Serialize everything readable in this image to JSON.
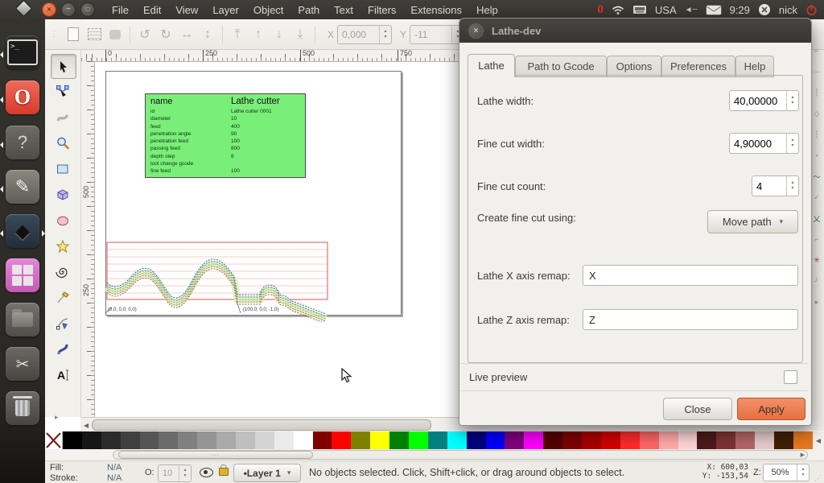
{
  "colors": {
    "accent_orange": "#e8703f",
    "table_green": "#79ef79",
    "panel_bg": "#3a3834"
  },
  "icons": {
    "close_x": "×",
    "minimize": "−",
    "maximize": "□",
    "chevron_down": "▾",
    "spin_up": "▴",
    "spin_down": "▾",
    "arrow_left": "◀",
    "arrow_right": "▶",
    "expander_right": "▸",
    "overflow_down": "▾",
    "grip_dots": "⋯",
    "undo": "↺",
    "redo": "↻",
    "flip_h": "↔",
    "flip_v": "↕",
    "raise_top": "⤒",
    "raise": "↑",
    "lower": "↓",
    "lower_bottom": "⤓",
    "terminal_prompt": ">_",
    "opera_o": "O",
    "help_q": "?",
    "edit_pencil": "✎",
    "inkscape_diamond": "◆",
    "scissors": "✂",
    "speaker_muted": "◄┄",
    "power": "⏻"
  },
  "panel": {
    "menus": [
      "File",
      "Edit",
      "View",
      "Layer",
      "Object",
      "Path",
      "Text",
      "Filters",
      "Extensions",
      "Help"
    ],
    "keyboard_layout": "USA",
    "clock": "9:29",
    "username": "nick"
  },
  "toolbar": {
    "x_label": "X",
    "x_value": "0,000",
    "y_label": "Y",
    "y_value": "-11"
  },
  "rulers": {
    "h": [
      "0",
      "250",
      "500",
      "750"
    ],
    "v": [
      "500",
      "250"
    ]
  },
  "canvas": {
    "table": {
      "header": {
        "name": "name",
        "value": "Lathe cutter"
      },
      "rows": [
        {
          "name": "id",
          "value": "Lathe cutter 0001"
        },
        {
          "name": "diameter",
          "value": "10"
        },
        {
          "name": "feed",
          "value": "400"
        },
        {
          "name": "penetration angle",
          "value": "90"
        },
        {
          "name": "penetration feed",
          "value": "100"
        },
        {
          "name": "passing feed",
          "value": "800"
        },
        {
          "name": "depth step",
          "value": "8"
        },
        {
          "name": "tool change gcode",
          "value": ""
        },
        {
          "name": "fine feed",
          "value": "100"
        }
      ]
    },
    "labels": {
      "origin": "(0,0; 0,0; 0,0)",
      "end": "(100,0; 0,0; -1,0)"
    }
  },
  "dialog": {
    "title": "Lathe-dev",
    "tabs": [
      "Lathe",
      "Path to Gcode",
      "Options",
      "Preferences",
      "Help"
    ],
    "active_tab": "Lathe",
    "fields": {
      "lathe_width": {
        "label": "Lathe width:",
        "value": "40,00000"
      },
      "fine_cut_width": {
        "label": "Fine cut width:",
        "value": "4,90000"
      },
      "fine_cut_count": {
        "label": "Fine cut count:",
        "value": "4"
      },
      "create_fine_cut": {
        "label": "Create fine cut using:",
        "value": "Move path"
      },
      "x_remap": {
        "label": "Lathe X axis remap:",
        "value": "X"
      },
      "z_remap": {
        "label": "Lathe Z axis remap:",
        "value": "Z"
      }
    },
    "live_preview_label": "Live preview",
    "buttons": {
      "close": "Close",
      "apply": "Apply"
    }
  },
  "statusbar": {
    "fill_label": "Fill:",
    "fill_value": "N/A",
    "stroke_label": "Stroke:",
    "stroke_value": "N/A",
    "opacity_label": "O:",
    "opacity_value": "10",
    "layer_button": "•Layer 1",
    "message": "No objects selected. Click, Shift+click, or drag around objects to select.",
    "x_label": "X:",
    "x_value": "600,03",
    "y_label": "Y:",
    "y_value": "-153,54",
    "z_label": "Z:",
    "zoom_value": "50%"
  },
  "palette": {
    "colors": [
      "#000000",
      "#161616",
      "#2b2b2b",
      "#404040",
      "#555555",
      "#6b6b6b",
      "#808080",
      "#959595",
      "#aaaaaa",
      "#bfbfbf",
      "#d4d4d4",
      "#eaeaea",
      "#ffffff",
      "#800000",
      "#ff0000",
      "#808000",
      "#ffff00",
      "#008000",
      "#00ff00",
      "#008080",
      "#00ffff",
      "#000080",
      "#0000ff",
      "#800080",
      "#ff00ff",
      "#550000",
      "#7f0000",
      "#aa0000",
      "#d40000",
      "#ff2a2a",
      "#ff6666",
      "#ffaaaa",
      "#ffd5d5",
      "#4d1a1a",
      "#803333",
      "#b36666",
      "#e6cccc",
      "#402000",
      "#e87820"
    ]
  }
}
